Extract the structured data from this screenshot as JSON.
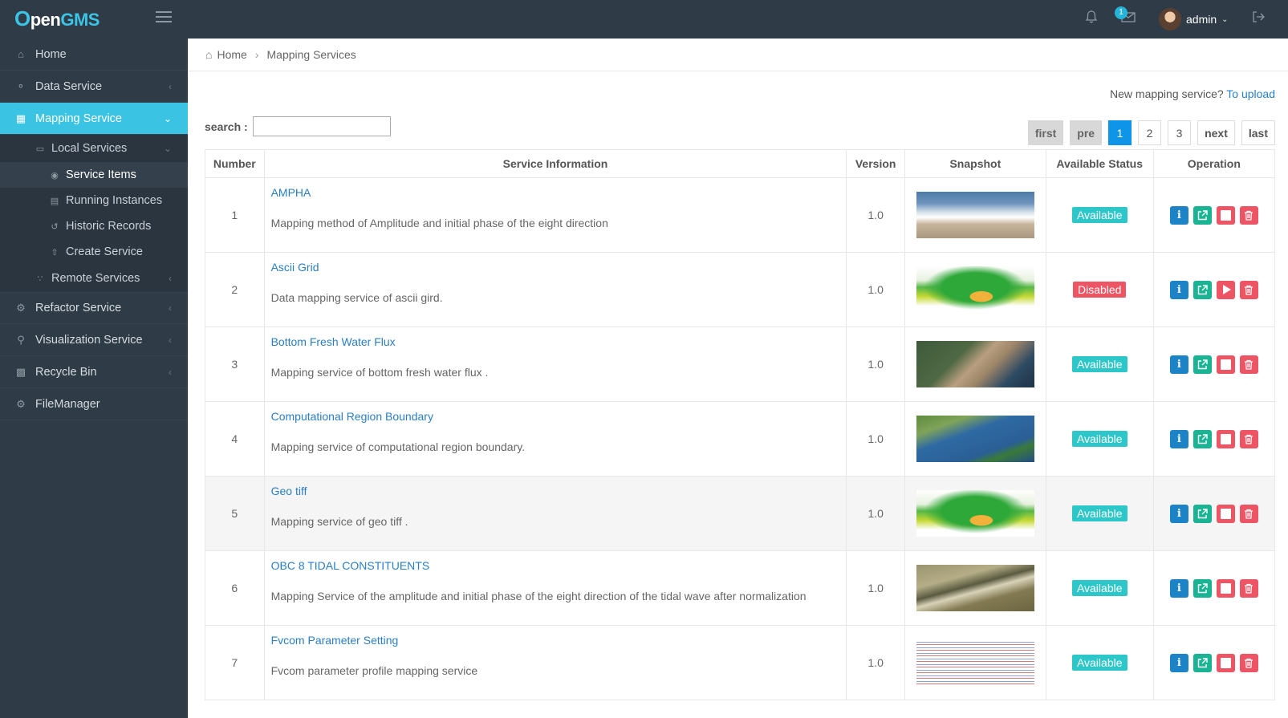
{
  "topbar": {
    "logo": {
      "o": "O",
      "pen": "pen",
      "gms": "GMS"
    },
    "mail_count": "1",
    "user": "admin"
  },
  "sidebar": {
    "home": "Home",
    "data_service": "Data Service",
    "mapping_service": "Mapping Service",
    "local_services": "Local Services",
    "service_items": "Service Items",
    "running_instances": "Running Instances",
    "historic_records": "Historic Records",
    "create_service": "Create Service",
    "remote_services": "Remote Services",
    "refactor_service": "Refactor Service",
    "visualization_service": "Visualization Service",
    "recycle_bin": "Recycle Bin",
    "file_manager": "FileManager"
  },
  "breadcrumb": {
    "home": "Home",
    "current": "Mapping Services"
  },
  "upload": {
    "prompt": "New mapping service?",
    "link": "To upload"
  },
  "search": {
    "label": "search :",
    "value": ""
  },
  "pager": {
    "first": "first",
    "pre": "pre",
    "p1": "1",
    "p2": "2",
    "p3": "3",
    "next": "next",
    "last": "last",
    "current": 1
  },
  "table": {
    "headers": {
      "number": "Number",
      "info": "Service Information",
      "version": "Version",
      "snapshot": "Snapshot",
      "status": "Available Status",
      "operation": "Operation"
    },
    "rows": [
      {
        "number": "1",
        "title": "AMPHA",
        "desc": "Mapping method of Amplitude and initial phase of the eight direction",
        "version": "1.0",
        "status": "Available",
        "snapshot": "coastal-wave"
      },
      {
        "number": "2",
        "title": "Ascii Grid",
        "desc": "Data mapping service of ascii gird.",
        "version": "1.0",
        "status": "Disabled",
        "snapshot": "terrain-3d"
      },
      {
        "number": "3",
        "title": "Bottom Fresh Water Flux",
        "desc": "Mapping service of bottom fresh water flux .",
        "version": "1.0",
        "status": "Available",
        "snapshot": "river-estuary"
      },
      {
        "number": "4",
        "title": "Computational Region Boundary",
        "desc": "Mapping service of computational region boundary.",
        "version": "1.0",
        "status": "Available",
        "snapshot": "ocean-region"
      },
      {
        "number": "5",
        "title": "Geo tiff",
        "desc": "Mapping service of geo tiff .",
        "version": "1.0",
        "status": "Available",
        "snapshot": "terrain-3d"
      },
      {
        "number": "6",
        "title": "OBC 8 TIDAL CONSTITUENTS",
        "desc": "Mapping Service of the amplitude and initial phase of the eight direction of the tidal wave after normalization",
        "version": "1.0",
        "status": "Available",
        "snapshot": "tidal-shore"
      },
      {
        "number": "7",
        "title": "Fvcom Parameter Setting",
        "desc": "Fvcom parameter profile mapping service",
        "version": "1.0",
        "status": "Available",
        "snapshot": "code-text"
      }
    ]
  },
  "colors": {
    "sidebar": "#2f3b46",
    "accent": "#3bc3e3",
    "link": "#2a7ec4",
    "available": "#2ec7c9",
    "disabled": "#ed5565",
    "page_current": "#0f95e8"
  }
}
